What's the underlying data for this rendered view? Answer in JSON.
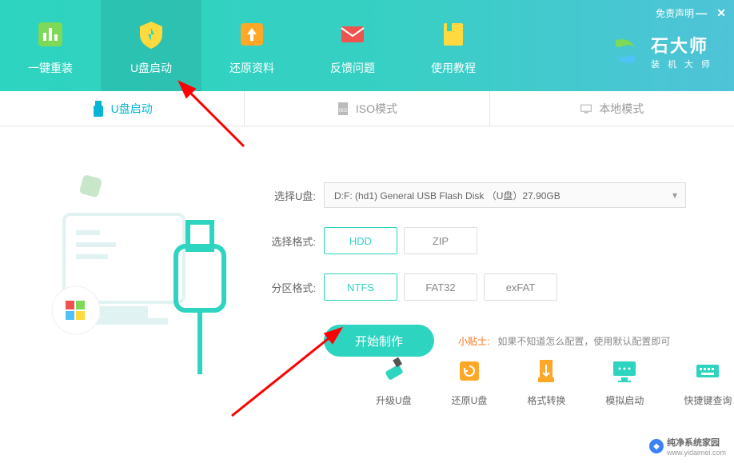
{
  "header": {
    "disclaimer": "免责声明",
    "nav": [
      {
        "label": "一键重装",
        "icon": "reinstall"
      },
      {
        "label": "U盘启动",
        "icon": "usb",
        "active": true
      },
      {
        "label": "还原资料",
        "icon": "restore"
      },
      {
        "label": "反馈问题",
        "icon": "feedback"
      },
      {
        "label": "使用教程",
        "icon": "tutorial"
      }
    ],
    "logo": {
      "title": "石大师",
      "subtitle": "装机大师"
    }
  },
  "subtabs": [
    {
      "label": "U盘启动",
      "icon": "usb-small",
      "active": true
    },
    {
      "label": "ISO模式",
      "icon": "iso"
    },
    {
      "label": "本地模式",
      "icon": "local"
    }
  ],
  "form": {
    "usb_label": "选择U盘:",
    "usb_value": "D:F: (hd1) General USB Flash Disk （U盘）27.90GB",
    "format_label": "选择格式:",
    "format_options": [
      "HDD",
      "ZIP"
    ],
    "format_selected": "HDD",
    "partition_label": "分区格式:",
    "partition_options": [
      "NTFS",
      "FAT32",
      "exFAT"
    ],
    "partition_selected": "NTFS",
    "start_button": "开始制作",
    "tip_label": "小贴士:",
    "tip_text": "如果不知道怎么配置，使用默认配置即可"
  },
  "tools": [
    {
      "label": "升级U盘",
      "icon": "upgrade"
    },
    {
      "label": "还原U盘",
      "icon": "restore-usb"
    },
    {
      "label": "格式转换",
      "icon": "convert"
    },
    {
      "label": "模拟启动",
      "icon": "simulate"
    },
    {
      "label": "快捷键查询",
      "icon": "shortcut"
    }
  ],
  "watermark": {
    "text": "纯净系统家园",
    "url": "www.yidaimei.com"
  }
}
